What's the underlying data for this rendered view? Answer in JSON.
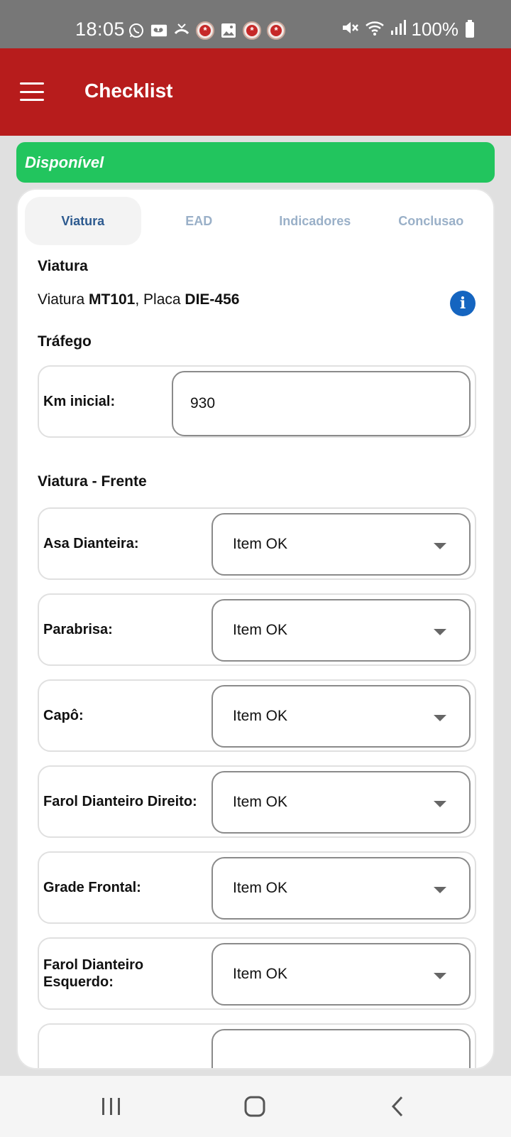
{
  "status_bar": {
    "time": "18:05",
    "battery": "100%",
    "notification_icons": [
      "whatsapp-icon",
      "voicemail-icon",
      "missed-call-icon",
      "medical-app-icon",
      "gallery-icon",
      "medical-app-icon",
      "medical-app-icon"
    ],
    "system_icons": [
      "mute-icon",
      "wifi-icon",
      "signal-icon",
      "battery-icon"
    ]
  },
  "app_bar": {
    "title": "Checklist"
  },
  "status_banner": {
    "text": "Disponível",
    "color": "#22c55e"
  },
  "tabs": [
    {
      "label": "Viatura",
      "active": true
    },
    {
      "label": "EAD",
      "active": false
    },
    {
      "label": "Indicadores",
      "active": false
    },
    {
      "label": "Conclusao",
      "active": false
    }
  ],
  "vehicle": {
    "section_title": "Viatura",
    "prefix": "Viatura ",
    "code": "MT101",
    "plate_prefix": ", Placa ",
    "plate": "DIE-456"
  },
  "traffic": {
    "section_title": "Tráfego",
    "km_label": "Km inicial:",
    "km_value": "930"
  },
  "front": {
    "section_title": "Viatura - Frente",
    "items": [
      {
        "label": "Asa Dianteira:",
        "value": "Item OK"
      },
      {
        "label": "Parabrisa:",
        "value": "Item OK"
      },
      {
        "label": "Capô:",
        "value": "Item OK"
      },
      {
        "label": "Farol Dianteiro Direito:",
        "value": "Item OK"
      },
      {
        "label": "Grade Frontal:",
        "value": "Item OK"
      },
      {
        "label": "Farol Dianteiro Esquerdo:",
        "value": "Item OK"
      }
    ]
  },
  "colors": {
    "app_bar": "#b71c1c",
    "status_bar": "#777777",
    "active_tab": "#2d5a8f",
    "inactive_tab": "#9ab0c8",
    "info_button": "#1565c0"
  }
}
